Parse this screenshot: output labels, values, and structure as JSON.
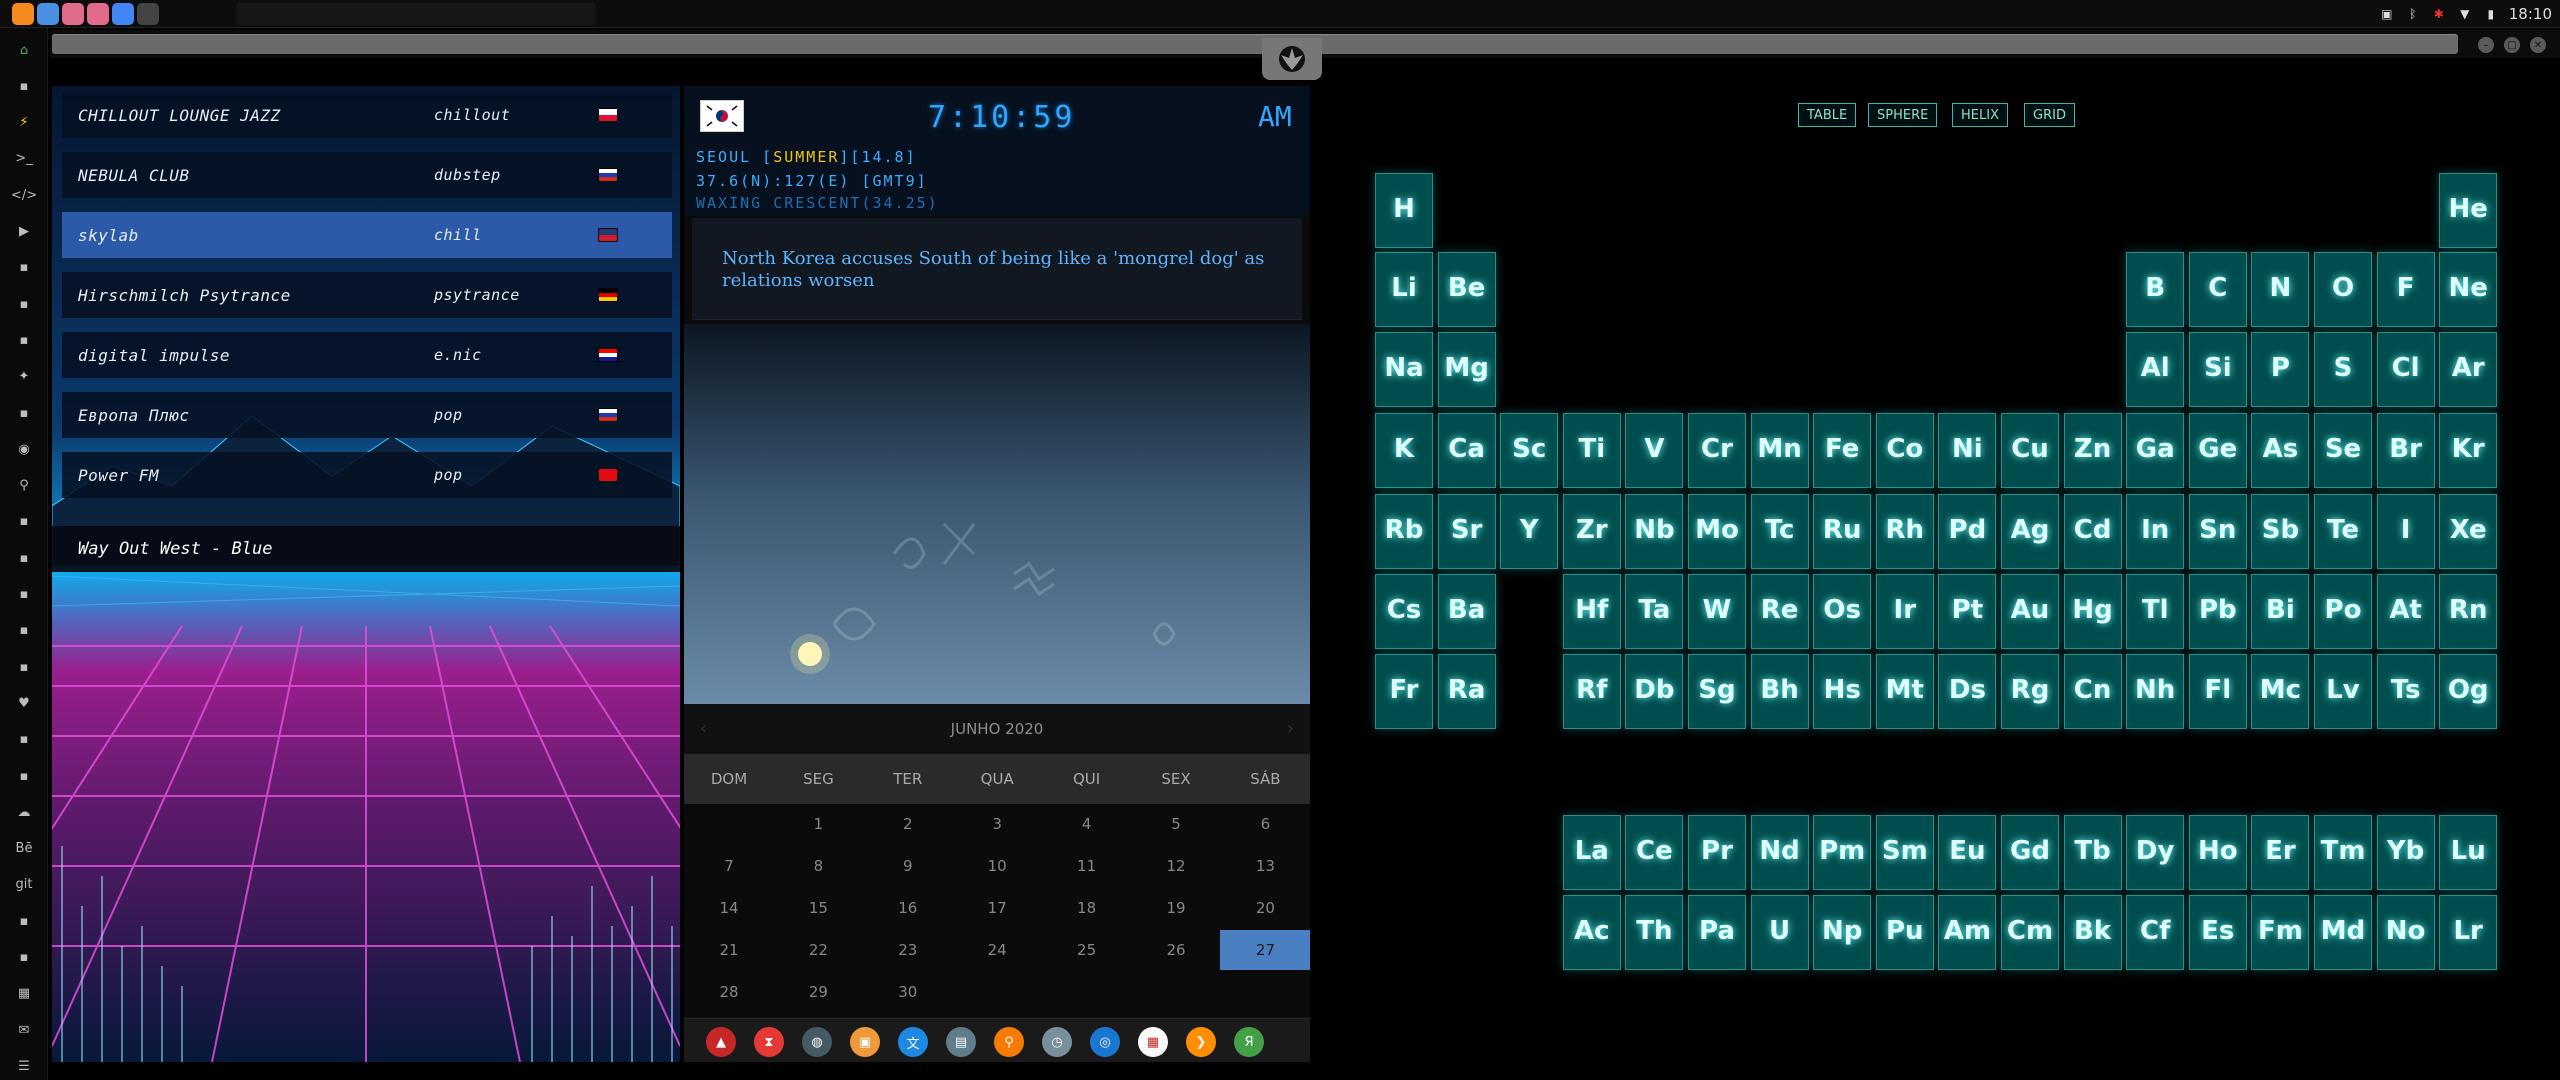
{
  "topbar": {
    "apps": [
      {
        "name": "sublime-app-icon",
        "color": "#f58a1f"
      },
      {
        "name": "files-app-icon",
        "color": "#4a90e2"
      },
      {
        "name": "vivaldi-app-icon",
        "color": "#e06b8b"
      },
      {
        "name": "vivaldi-app-icon-2",
        "color": "#e06b8b"
      },
      {
        "name": "chrome-app-icon",
        "color": "#4285f4"
      },
      {
        "name": "window-app-icon",
        "color": "#444444"
      }
    ],
    "time": "18:10"
  },
  "radio": {
    "stations": [
      {
        "name": "CHILLOUT LOUNGE JAZZ",
        "genre": "chillout",
        "flag": "poland"
      },
      {
        "name": "NEBULA CLUB",
        "genre": "dubstep",
        "flag": "russia"
      },
      {
        "name": "skylab",
        "genre": "chill",
        "flag": "uk"
      },
      {
        "name": "Hirschmilch Psytrance",
        "genre": "psytrance",
        "flag": "germany"
      },
      {
        "name": "digital impulse",
        "genre": "e.nic",
        "flag": "croatia"
      },
      {
        "name": "Европа Плюс",
        "genre": "pop",
        "flag": "russia"
      },
      {
        "name": "Power FM",
        "genre": "pop",
        "flag": "turkey"
      }
    ],
    "selected_index": 2,
    "now_playing": "Way Out West - Blue"
  },
  "clock": {
    "time": "7:10:59",
    "ampm": "AM",
    "city_prefix": "SEOUL [",
    "season": "SUMMER",
    "temp_suffix": "][14.8]",
    "coords": "37.6(N):127(E) [GMT9]",
    "moon": "WAXING CRESCENT(34.25)"
  },
  "news": {
    "headline": "North Korea accuses South of being like a 'mongrel dog' as relations worsen"
  },
  "calendar": {
    "month": "JUNHO 2020",
    "weekdays": [
      "DOM",
      "SEG",
      "TER",
      "QUA",
      "QUI",
      "SEX",
      "SÁB"
    ],
    "days": [
      [
        "",
        "1",
        "2",
        "3",
        "4",
        "5",
        "6"
      ],
      [
        "7",
        "8",
        "9",
        "10",
        "11",
        "12",
        "13"
      ],
      [
        "14",
        "15",
        "16",
        "17",
        "18",
        "19",
        "20"
      ],
      [
        "21",
        "22",
        "23",
        "24",
        "25",
        "26",
        "27"
      ],
      [
        "28",
        "29",
        "30",
        "",
        "",
        "",
        ""
      ]
    ],
    "today": "27"
  },
  "periodic": {
    "views": [
      "TABLE",
      "SPHERE",
      "HELIX",
      "GRID"
    ]
  }
}
